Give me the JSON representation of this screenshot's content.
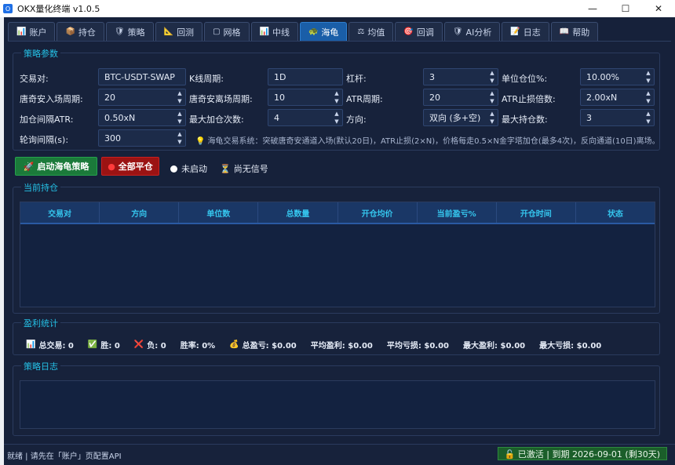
{
  "window": {
    "title": "OKX量化终端 v1.0.5",
    "min": "—",
    "max": "☐",
    "close": "✕"
  },
  "tabs": [
    {
      "icon": "📊",
      "label": "账户"
    },
    {
      "icon": "📦",
      "label": "持仓"
    },
    {
      "icon": "🛡",
      "label": "策略"
    },
    {
      "icon": "📐",
      "label": "回测"
    },
    {
      "icon": "▢",
      "label": "网格"
    },
    {
      "icon": "📊",
      "label": "中线"
    },
    {
      "icon": "🐢",
      "label": "海龟"
    },
    {
      "icon": "⚖",
      "label": "均值"
    },
    {
      "icon": "🎯",
      "label": "回调"
    },
    {
      "icon": "🛡",
      "label": "AI分析"
    },
    {
      "icon": "📝",
      "label": "日志"
    },
    {
      "icon": "📖",
      "label": "帮助"
    }
  ],
  "active_tab": 6,
  "params": {
    "title": "策略参数",
    "row1": {
      "pair_label": "交易对:",
      "pair_value": "BTC-USDT-SWAP",
      "kline_label": "K线周期:",
      "kline_value": "1D",
      "lever_label": "杠杆:",
      "lever_value": "3",
      "unit_label": "单位仓位%:",
      "unit_value": "10.00%"
    },
    "row2": {
      "entry_label": "唐奇安入场周期:",
      "entry_value": "20",
      "exit_label": "唐奇安离场周期:",
      "exit_value": "10",
      "atr_label": "ATR周期:",
      "atr_value": "20",
      "stop_label": "ATR止损倍数:",
      "stop_value": "2.00xN"
    },
    "row3": {
      "add_label": "加仓间隔ATR:",
      "add_value": "0.50xN",
      "maxadd_label": "最大加仓次数:",
      "maxadd_value": "4",
      "dir_label": "方向:",
      "dir_value": "双向 (多+空)",
      "maxpos_label": "最大持仓数:",
      "maxpos_value": "3"
    },
    "row4": {
      "poll_label": "轮询间隔(s):",
      "poll_value": "300",
      "hint": "海龟交易系统：突破唐奇安通道入场(默认20日)，ATR止损(2×N)，价格每走0.5×N金字塔加仓(最多4次)，反向通道(10日)离场。",
      "hint_icon": "💡"
    }
  },
  "actions": {
    "start_label": "启动海龟策略",
    "start_icon": "🚀",
    "close_all_label": "全部平仓",
    "close_all_icon": "●",
    "state_label": "未启动",
    "signal_icon": "⏳",
    "signal_label": "尚无信号"
  },
  "positions": {
    "title": "当前持仓",
    "columns": [
      "交易对",
      "方向",
      "单位数",
      "总数量",
      "开仓均价",
      "当前盈亏%",
      "开仓时间",
      "状态"
    ],
    "rows": []
  },
  "stats": {
    "title": "盈利统计",
    "items": [
      {
        "icon": "📊",
        "text": "总交易: 0"
      },
      {
        "icon": "✅",
        "text": "胜: 0"
      },
      {
        "icon": "❌",
        "text": "负: 0"
      },
      {
        "icon": "",
        "text": "胜率: 0%"
      },
      {
        "icon": "💰",
        "text": "总盈亏: $0.00"
      },
      {
        "icon": "",
        "text": "平均盈利: $0.00"
      },
      {
        "icon": "",
        "text": "平均亏损: $0.00"
      },
      {
        "icon": "",
        "text": "最大盈利: $0.00"
      },
      {
        "icon": "",
        "text": "最大亏损: $0.00"
      }
    ]
  },
  "log": {
    "title": "策略日志"
  },
  "statusbar": {
    "left": "就绪 | 请先在「账户」页配置API",
    "right": "🔓 已激活 | 到期 2026-09-01 (剩30天)"
  }
}
